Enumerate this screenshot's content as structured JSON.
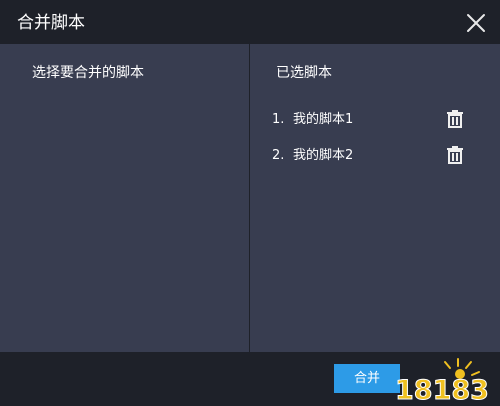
{
  "dialog": {
    "title": "合并脚本"
  },
  "left_pane": {
    "title": "选择要合并的脚本"
  },
  "right_pane": {
    "title": "已选脚本",
    "items": [
      {
        "num": "1.",
        "name": "我的脚本1"
      },
      {
        "num": "2.",
        "name": "我的脚本2"
      }
    ]
  },
  "footer": {
    "merge_label": "合并"
  },
  "watermark": {
    "text": "18183"
  },
  "colors": {
    "panel": "#383d50",
    "chrome": "#1e2129",
    "accent": "#2d9be7",
    "logo": "#f0c020"
  },
  "icons": {
    "close": "close-icon",
    "delete": "trash-icon"
  }
}
